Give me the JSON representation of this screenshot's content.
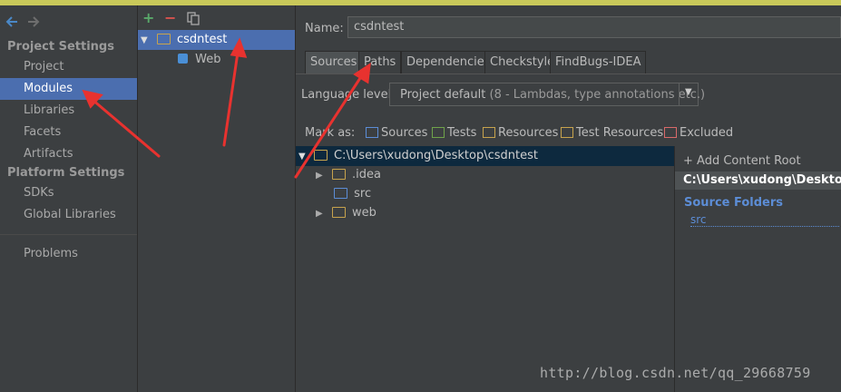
{
  "nav": {
    "project_settings_header": "Project Settings",
    "items_project": [
      "Project",
      "Modules",
      "Libraries",
      "Facets",
      "Artifacts"
    ],
    "platform_settings_header": "Platform Settings",
    "items_platform": [
      "SDKs",
      "Global Libraries"
    ],
    "problems": "Problems",
    "selected": "Modules"
  },
  "tree": {
    "toolbar": {
      "add": "+",
      "remove": "−"
    },
    "module": "csdntest",
    "facet": "Web"
  },
  "main": {
    "name_label": "Name:",
    "name_value": "csdntest",
    "tabs": [
      "Sources",
      "Paths",
      "Dependencies",
      "Checkstyle",
      "FindBugs-IDEA"
    ],
    "selected_tab": "Sources",
    "language_level_label": "Language level:",
    "language_level_value": "Project default",
    "language_level_detail": "(8 - Lambdas, type annotations etc.)",
    "mark_as_label": "Mark as:",
    "mark_as": [
      {
        "label": "Sources",
        "color": "#5c8dd6"
      },
      {
        "label": "Tests",
        "color": "#6fa34a"
      },
      {
        "label": "Resources",
        "color": "#c7a34d"
      },
      {
        "label": "Test Resources",
        "color": "#c7a34d"
      },
      {
        "label": "Excluded",
        "color": "#d96a6a"
      }
    ],
    "folder_tree": {
      "root": "C:\\Users\\xudong\\Desktop\\csdntest",
      "children": [
        ".idea",
        "src",
        "web"
      ]
    },
    "right_panel": {
      "add_content_root": "+ Add Content Root",
      "content_root": "C:\\Users\\xudong\\Desktop\\c",
      "source_folders_header": "Source Folders",
      "source_folder": "src"
    }
  },
  "watermark": "http://blog.csdn.net/qq_29668759",
  "colors": {
    "selection": "#4b6eaf",
    "annotation_arrow": "#e8322f",
    "source_blue": "#5c8dd6"
  }
}
